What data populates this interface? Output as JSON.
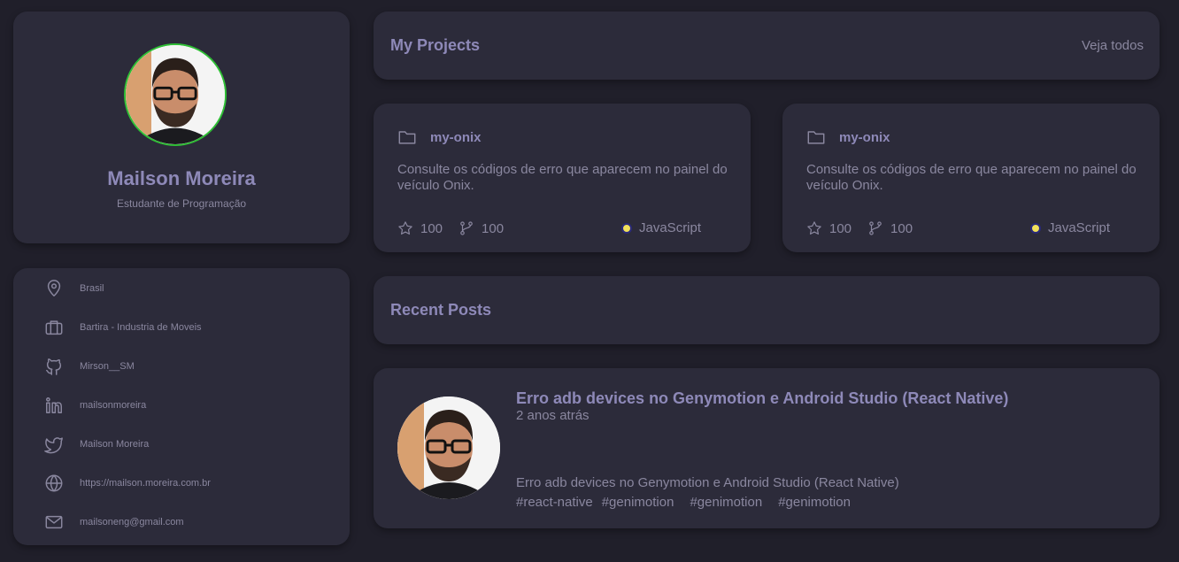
{
  "profile": {
    "name": "Mailson Moreira",
    "role": "Estudante de Programação"
  },
  "info": {
    "location": "Brasil",
    "company": "Bartira - Industria de Moveis",
    "github": "Mirson__SM",
    "linkedin": "mailsonmoreira",
    "twitter": "Mailson Moreira",
    "website": "https://mailson.moreira.com.br",
    "email": "mailsoneng@gmail.com"
  },
  "projects_header": {
    "title": "My Projects",
    "link": "Veja todos"
  },
  "projects": [
    {
      "name": "my-onix",
      "description": "Consulte os códigos de erro que aparecem no painel do veículo Onix.",
      "stars": "100",
      "forks": "100",
      "language": "JavaScript"
    },
    {
      "name": "my-onix",
      "description": "Consulte os códigos de erro que aparecem no painel do veículo Onix.",
      "stars": "100",
      "forks": "100",
      "language": "JavaScript"
    }
  ],
  "posts_header": {
    "title": "Recent Posts"
  },
  "post": {
    "title": "Erro adb devices no Genymotion e Android Studio (React Native)",
    "date": "2 anos atrás",
    "body": "Erro adb devices no Genymotion e Android Studio (React Native)",
    "tags": [
      "#react-native",
      "#genimotion",
      "#genimotion",
      "#genimotion"
    ]
  },
  "colors": {
    "background": "#201f2a",
    "card": "#2c2b3a",
    "accent_text": "#8e89b8",
    "avatar_ring": "#2fbf35",
    "language_dot": "#f1e05a"
  }
}
